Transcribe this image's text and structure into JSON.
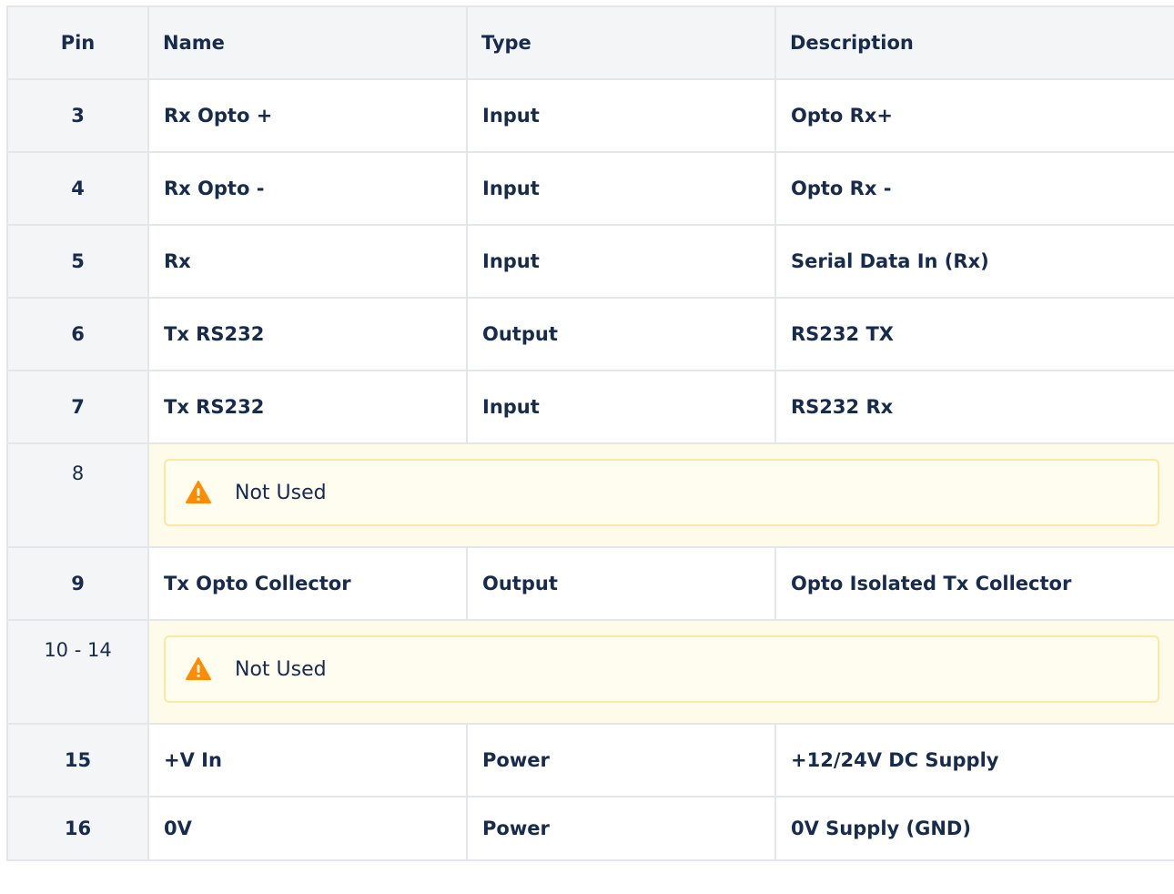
{
  "header": {
    "pin": "Pin",
    "name": "Name",
    "type": "Type",
    "description": "Description"
  },
  "rows": [
    {
      "kind": "data",
      "pin": "3",
      "name": "Rx Opto +",
      "type": "Input",
      "description": "Opto Rx+"
    },
    {
      "kind": "data",
      "pin": "4",
      "name": "Rx Opto -",
      "type": "Input",
      "description": "Opto Rx -"
    },
    {
      "kind": "data",
      "pin": "5",
      "name": "Rx",
      "type": "Input",
      "description": "Serial Data In (Rx)"
    },
    {
      "kind": "data",
      "pin": "6",
      "name": "Tx RS232",
      "type": "Output",
      "description": "RS232 TX"
    },
    {
      "kind": "data",
      "pin": "7",
      "name": "Tx RS232",
      "type": "Input",
      "description": "RS232 Rx"
    },
    {
      "kind": "note",
      "pin": "8",
      "note": "Not Used",
      "icon": "warning-icon"
    },
    {
      "kind": "data",
      "pin": "9",
      "name": "Tx Opto Collector",
      "type": "Output",
      "description": "Opto Isolated Tx Collector"
    },
    {
      "kind": "note",
      "pin": "10 - 14",
      "note": "Not Used",
      "icon": "warning-icon"
    },
    {
      "kind": "data",
      "pin": "15",
      "name": "+V In",
      "type": "Power",
      "description": "+12/24V DC Supply"
    },
    {
      "kind": "data",
      "pin": "16",
      "name": "0V",
      "type": "Power",
      "description": "0V Supply (GND)"
    }
  ],
  "colors": {
    "header_bg": "#f4f5f7",
    "border": "#e4e6ea",
    "note_bg": "#fffbea",
    "note_border": "#fae8a6",
    "warning": "#ff8b00"
  }
}
